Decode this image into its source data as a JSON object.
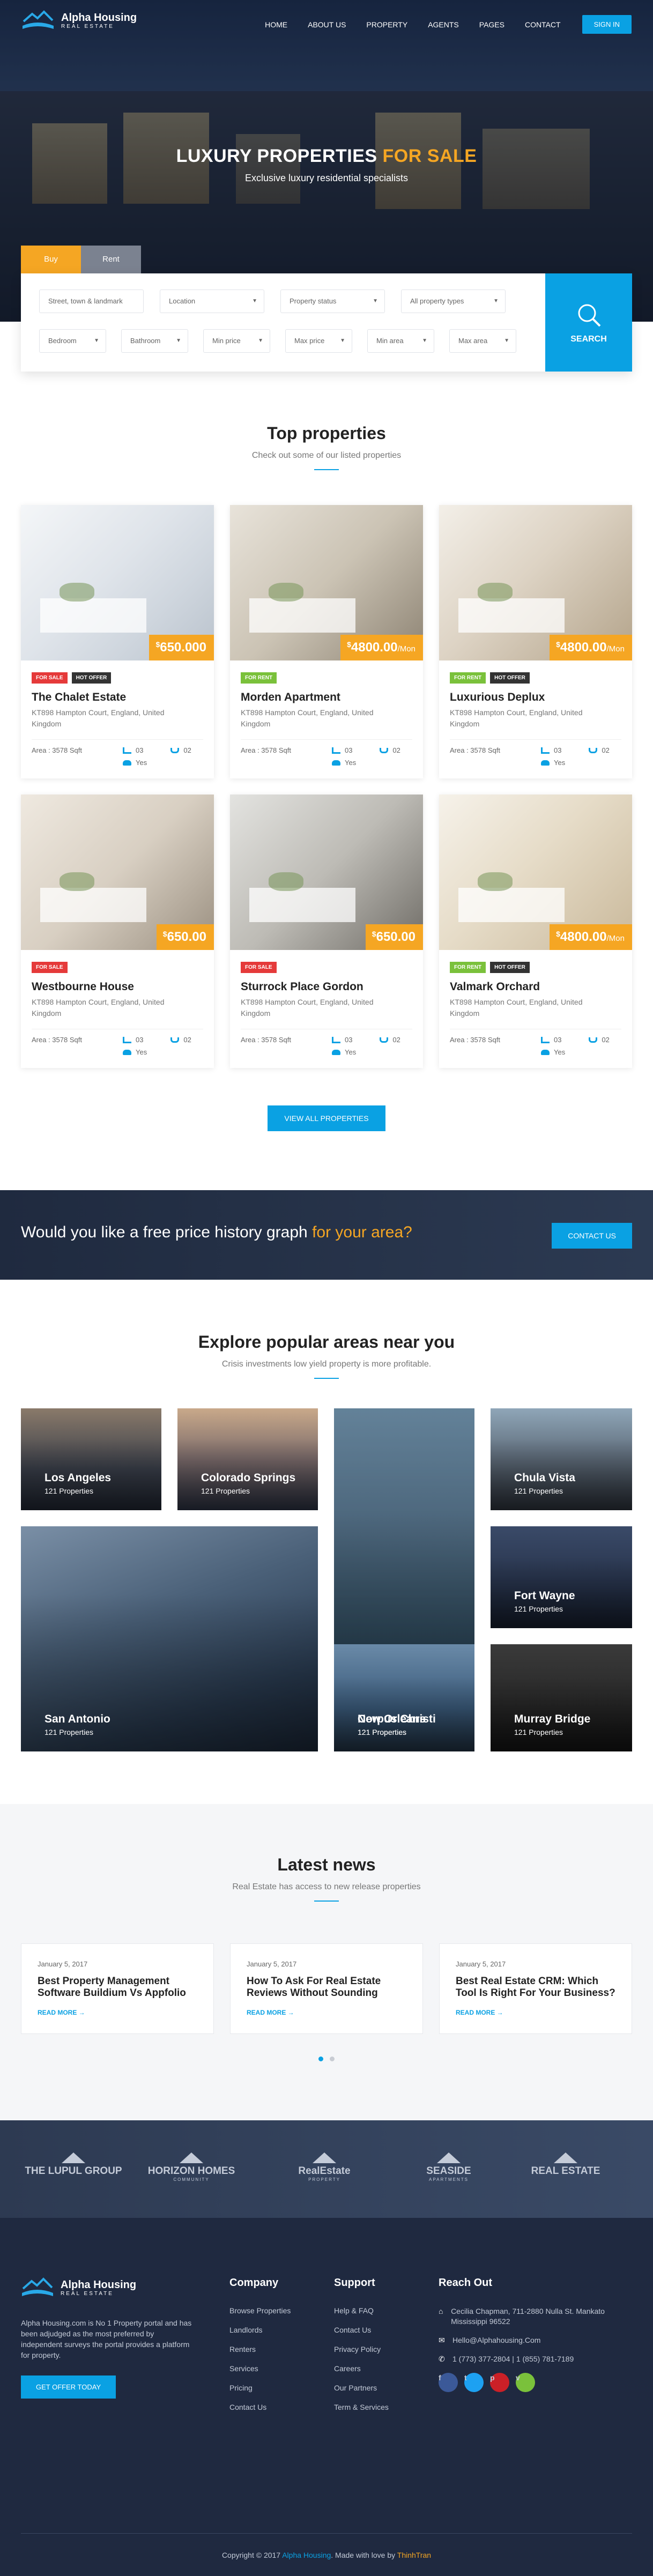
{
  "nav": {
    "brand": "Alpha Housing",
    "tagline": "REAL ESTATE",
    "items": [
      "HOME",
      "ABOUT US",
      "PROPERTY",
      "AGENTS",
      "PAGES",
      "CONTACT"
    ],
    "signin": "SIGN IN"
  },
  "hero": {
    "title_main": "LUXURY PROPERTIES",
    "title_highlight": "FOR SALE",
    "subtitle": "Exclusive luxury residential specialists"
  },
  "search": {
    "tabs": [
      "Buy",
      "Rent"
    ],
    "row1": [
      "Street, town & landmark",
      "Location",
      "Property status",
      "All property types"
    ],
    "row2": [
      "Bedroom",
      "Bathroom",
      "Min price",
      "Max price",
      "Min area",
      "Max area"
    ],
    "button": "SEARCH"
  },
  "top": {
    "title": "Top properties",
    "subtitle": "Check out some of our listed properties",
    "view_all": "VIEW ALL PROPERTIES",
    "properties": [
      {
        "name": "The Chalet Estate",
        "addr": "KT898 Hampton Court, England, United Kingdom",
        "cur": "$",
        "price": "650.000",
        "per": "",
        "badges": [
          "FOR SALE",
          "HOT OFFER"
        ],
        "area": "Area : 3578 Sqft",
        "beds": "03",
        "baths": "02",
        "garage": "Yes"
      },
      {
        "name": "Morden Apartment",
        "addr": "KT898 Hampton Court, England, United Kingdom",
        "cur": "$",
        "price": "4800.00",
        "per": "/Mon",
        "badges": [
          "FOR RENT"
        ],
        "area": "Area : 3578 Sqft",
        "beds": "03",
        "baths": "02",
        "garage": "Yes"
      },
      {
        "name": "Luxurious Deplux",
        "addr": "KT898 Hampton Court, England, United Kingdom",
        "cur": "$",
        "price": "4800.00",
        "per": "/Mon",
        "badges": [
          "FOR RENT",
          "HOT OFFER"
        ],
        "area": "Area : 3578 Sqft",
        "beds": "03",
        "baths": "02",
        "garage": "Yes"
      },
      {
        "name": "Westbourne House",
        "addr": "KT898 Hampton Court, England, United Kingdom",
        "cur": "$",
        "price": "650.00",
        "per": "",
        "badges": [
          "FOR SALE"
        ],
        "area": "Area : 3578 Sqft",
        "beds": "03",
        "baths": "02",
        "garage": "Yes"
      },
      {
        "name": "Sturrock Place Gordon",
        "addr": "KT898 Hampton Court, England, United Kingdom",
        "cur": "$",
        "price": "650.00",
        "per": "",
        "badges": [
          "FOR SALE"
        ],
        "area": "Area : 3578 Sqft",
        "beds": "03",
        "baths": "02",
        "garage": "Yes"
      },
      {
        "name": "Valmark Orchard",
        "addr": "KT898 Hampton Court, England, United Kingdom",
        "cur": "$",
        "price": "4800.00",
        "per": "/Mon",
        "badges": [
          "FOR RENT",
          "HOT OFFER"
        ],
        "area": "Area : 3578 Sqft",
        "beds": "03",
        "baths": "02",
        "garage": "Yes"
      }
    ]
  },
  "badge_colors": {
    "FOR SALE": "#e53a3a",
    "HOT OFFER": "#333333",
    "FOR RENT": "#7ac13b"
  },
  "cta": {
    "text": "Would you like a free price history graph",
    "highlight": "for your area?",
    "button": "CONTACT US"
  },
  "areas": {
    "title": "Explore popular areas near you",
    "subtitle": "Crisis investments low yield property is more profitable.",
    "items": [
      {
        "name": "Los Angeles",
        "count": "121 Properties"
      },
      {
        "name": "Colorado Springs",
        "count": "121 Properties"
      },
      {
        "name": "New Orleans",
        "count": "121 Properties"
      },
      {
        "name": "Chula Vista",
        "count": "121 Properties"
      },
      {
        "name": "San Antonio",
        "count": "121 Properties"
      },
      {
        "name": "Fort Wayne",
        "count": "121 Properties"
      },
      {
        "name": "Corpus Christi",
        "count": "121 Properties"
      },
      {
        "name": "Murray Bridge",
        "count": "121 Properties"
      }
    ]
  },
  "news": {
    "title": "Latest news",
    "subtitle": "Real Estate has access to new release properties",
    "items": [
      {
        "date": "January 5, 2017",
        "title": "Best Property Management Software Buildium Vs Appfolio",
        "more": "READ MORE →"
      },
      {
        "date": "January 5, 2017",
        "title": "How To Ask For Real Estate Reviews Without Sounding",
        "more": "READ MORE →"
      },
      {
        "date": "January 5, 2017",
        "title": "Best Real Estate CRM: Which Tool Is Right For Your Business?",
        "more": "READ MORE →"
      }
    ]
  },
  "partners": [
    {
      "name": "THE LUPUL GROUP",
      "sub": ""
    },
    {
      "name": "HORIZON HOMES",
      "sub": "COMMUNITY"
    },
    {
      "name": "RealEstate",
      "sub": "PROPERTY"
    },
    {
      "name": "SEASIDE",
      "sub": "APARTMENTS"
    },
    {
      "name": "REAL ESTATE",
      "sub": ""
    }
  ],
  "footer": {
    "about": "Alpha Housing.com is No 1 Property portal and has been adjudged as the most preferred by independent surveys the portal provides a platform for property.",
    "get_offer": "GET OFFER TODAY",
    "company_title": "Company",
    "company": [
      "Browse Properties",
      "Landlords",
      "Renters",
      "Services",
      "Pricing",
      "Contact Us"
    ],
    "support_title": "Support",
    "support": [
      "Help & FAQ",
      "Contact Us",
      "Privacy Policy",
      "Careers",
      "Our Partners",
      "Term & Services"
    ],
    "reach_title": "Reach Out",
    "address": "Cecilia Chapman, 711-2880 Nulla St. Mankato Mississippi 96522",
    "email": "Hello@Alphahousing.Com",
    "phone": "1 (773) 377-2804 | 1 (855) 781-7189",
    "copy_pre": "Copyright © 2017",
    "copy_brand": "Alpha Housing",
    "copy_mid": ". Made with love by",
    "copy_author": "ThinhTran"
  }
}
